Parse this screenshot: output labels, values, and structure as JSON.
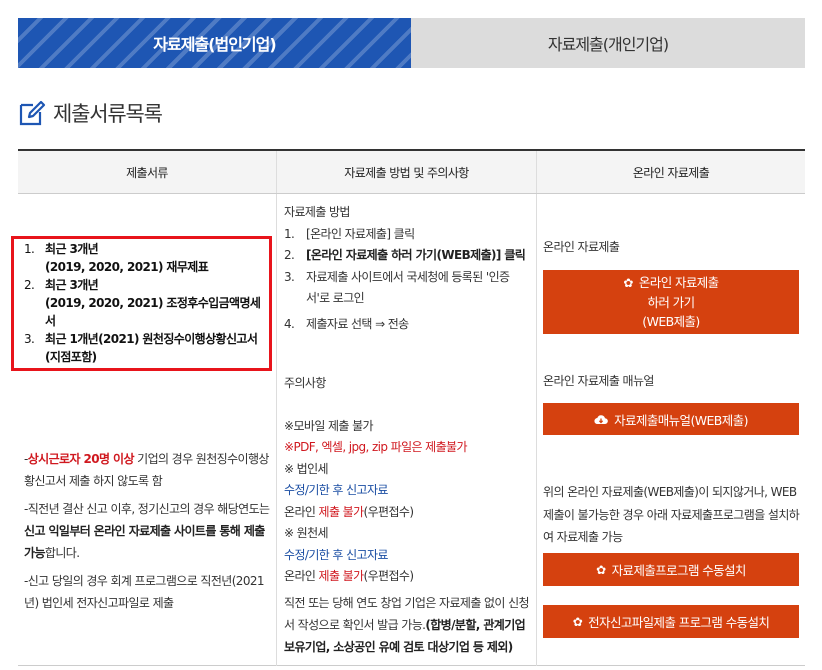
{
  "tabs": {
    "corporate": "자료제출(법인기업)",
    "individual": "자료제출(개인기업)"
  },
  "section": {
    "title": "제출서류목록"
  },
  "table": {
    "headers": [
      "제출서류",
      "자료제출 방법 및 주의사항",
      "온라인 자료제출"
    ]
  },
  "documents": [
    {
      "num": "1.",
      "line1": "최근 3개년",
      "line2": "(2019, 2020, 2021) 재무제표"
    },
    {
      "num": "2.",
      "line1": "최근 3개년",
      "line2": "(2019, 2020, 2021) 조정후수입금액명세서"
    },
    {
      "num": "3.",
      "line1": "최근 1개년(2021) 원천징수이행상황신고서",
      "line2": "(지점포함)"
    }
  ],
  "notes_col1": {
    "p1_red": "상시근로자 20명 이상",
    "p1_rest": " 기업의 경우 원천징수이행상황신고서 제출 하지 않도록 함",
    "p2_pre": "-직전년 결산 신고 이후, 정기신고의 경우 해당연도는 ",
    "p2_bold": "신고 익일부터 온라인 자료제출 사이트를 통해 제출 가능",
    "p2_post": "합니다.",
    "p3": "-신고 당일의 경우 회계 프로그램으로 직전년(2021년) 법인세 전자신고파일로 제출"
  },
  "method": {
    "heading": "자료제출 방법",
    "steps": [
      {
        "num": "1.",
        "text": "[온라인 자료제출] 클릭"
      },
      {
        "num": "2.",
        "text": "[온라인 자료제출 하러 가기(WEB제출)] 클릭"
      },
      {
        "num": "3.",
        "text": "자료제출 사이트에서 국세청에 등록된 '인증서'로 로그인"
      },
      {
        "num": "4.",
        "text": "제출자료 선택 ⇒ 전송"
      }
    ],
    "caution_heading": "주의사항",
    "mobile": "※모바일 제출 불가",
    "formats": "※PDF, 엑셀, jpg, zip 파일은 제출불가",
    "corp_tax": "※ 법인세",
    "corp_amend": "수정/기한 후 신고자료",
    "corp_online_pre": "온라인 ",
    "corp_online_red": "제출 불가",
    "corp_online_post": "(우편접수)",
    "withholding": "※ 원천세",
    "with_amend": "수정/기한 후 신고자료",
    "with_online_pre": "온라인 ",
    "with_online_red": "제출 불가",
    "with_online_post": "(우편접수)",
    "final_pre": "직전 또는 당해 연도 창업 기업은 자료제출 없이 신청서 작성으로 확인서 발급 가능.",
    "final_bold": "(합병/분할, 관계기업 보유기업, 소상공인 유예 검토 대상기업 등 제외)"
  },
  "online": {
    "label1": "온라인 자료제출",
    "btn1_line1": "온라인 자료제출",
    "btn1_line2": "하러 가기",
    "btn1_line3": "(WEB제출)",
    "label2": "온라인 자료제출 매뉴얼",
    "btn2": "자료제출매뉴얼(WEB제출)",
    "note": "위의 온라인 자료제출(WEB제출)이 되지않거나, WEB제출이 불가능한 경우 아래 자료제출프로그램을 설치하여 자료제출 가능",
    "btn3": "자료제출프로그램 수동설치",
    "btn4": "전자신고파일제출 프로그램 수동설치"
  },
  "colors": {
    "tab_active": "#1e56b3",
    "tab_inactive": "#dcdcdc",
    "button": "#d5410f",
    "highlight_box": "#e8141b",
    "red_text": "#d0181f",
    "blue_text": "#1b4ea3"
  },
  "icons": {
    "title": "edit-icon",
    "button_gear": "gear-icon",
    "button_cloud": "cloud-download-icon"
  }
}
